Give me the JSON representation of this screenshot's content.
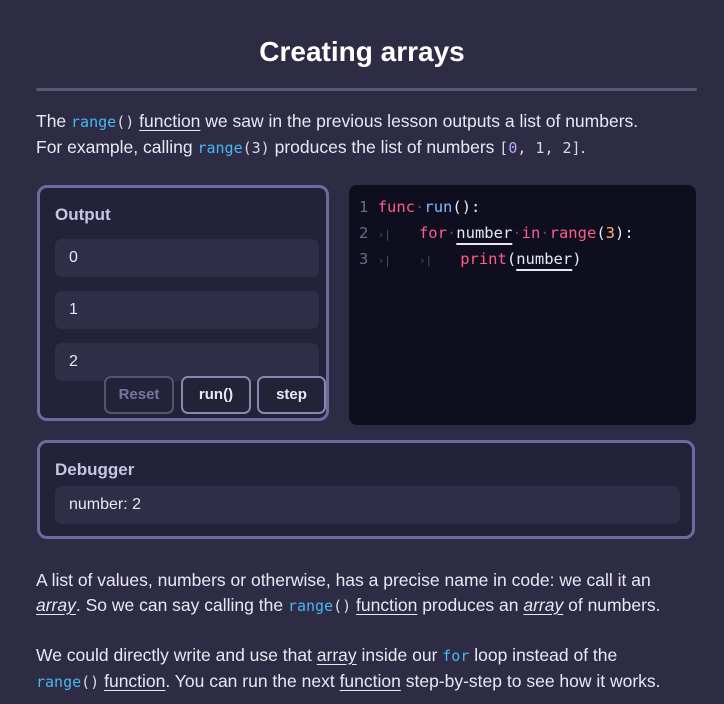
{
  "lesson": {
    "title": "Creating arrays"
  },
  "intro": {
    "t1": "The ",
    "range_code": "range",
    "parens": "()",
    "function_word": "function",
    "t2": " we saw in the previous lesson outputs a list of numbers.",
    "t3": "For example, calling ",
    "range3_name": "range",
    "range3_args": "(3)",
    "t4": " produces the list of numbers ",
    "list_open": "[",
    "list_0": "0",
    "list_sep1": ", ",
    "list_1": "1",
    "list_sep2": ", ",
    "list_2": "2",
    "list_close": "]",
    "t5": "."
  },
  "output_panel": {
    "label": "Output",
    "rows": [
      "0",
      "1",
      "2"
    ],
    "buttons": {
      "reset": "Reset",
      "run": "run()",
      "step": "step"
    }
  },
  "code": {
    "line_numbers": [
      "1",
      "2",
      "3"
    ],
    "tab_marker": "›|",
    "l1_kw": "func",
    "l1_name": "run",
    "l1_rest": "():",
    "l2_kw": "for",
    "l2_var": "number",
    "l2_in": "in",
    "l2_fn": "range",
    "l2_open": "(",
    "l2_num": "3",
    "l2_close": "):",
    "l3_fn": "print",
    "l3_open": "(",
    "l3_var": "number",
    "l3_close": ")"
  },
  "debugger": {
    "label": "Debugger",
    "value": "number: 2"
  },
  "para2": {
    "a": "A list of values, numbers or otherwise, has a precise name in code: we call it an",
    "array1": "array",
    "b": ". So we can say calling the ",
    "range_code": "range",
    "parens": "()",
    "function_word": "function",
    "c": " produces an ",
    "array2": "array",
    "d": " of numbers."
  },
  "para3": {
    "a": "We could directly write and use that ",
    "array": "array",
    "b": " inside our ",
    "for_code": "for",
    "c": " loop instead of the",
    "range_code": "range",
    "parens": "()",
    "function_word": "function",
    "d": ". You can run the next ",
    "function_word2": "function",
    "e": " step-by-step to see how it works."
  }
}
